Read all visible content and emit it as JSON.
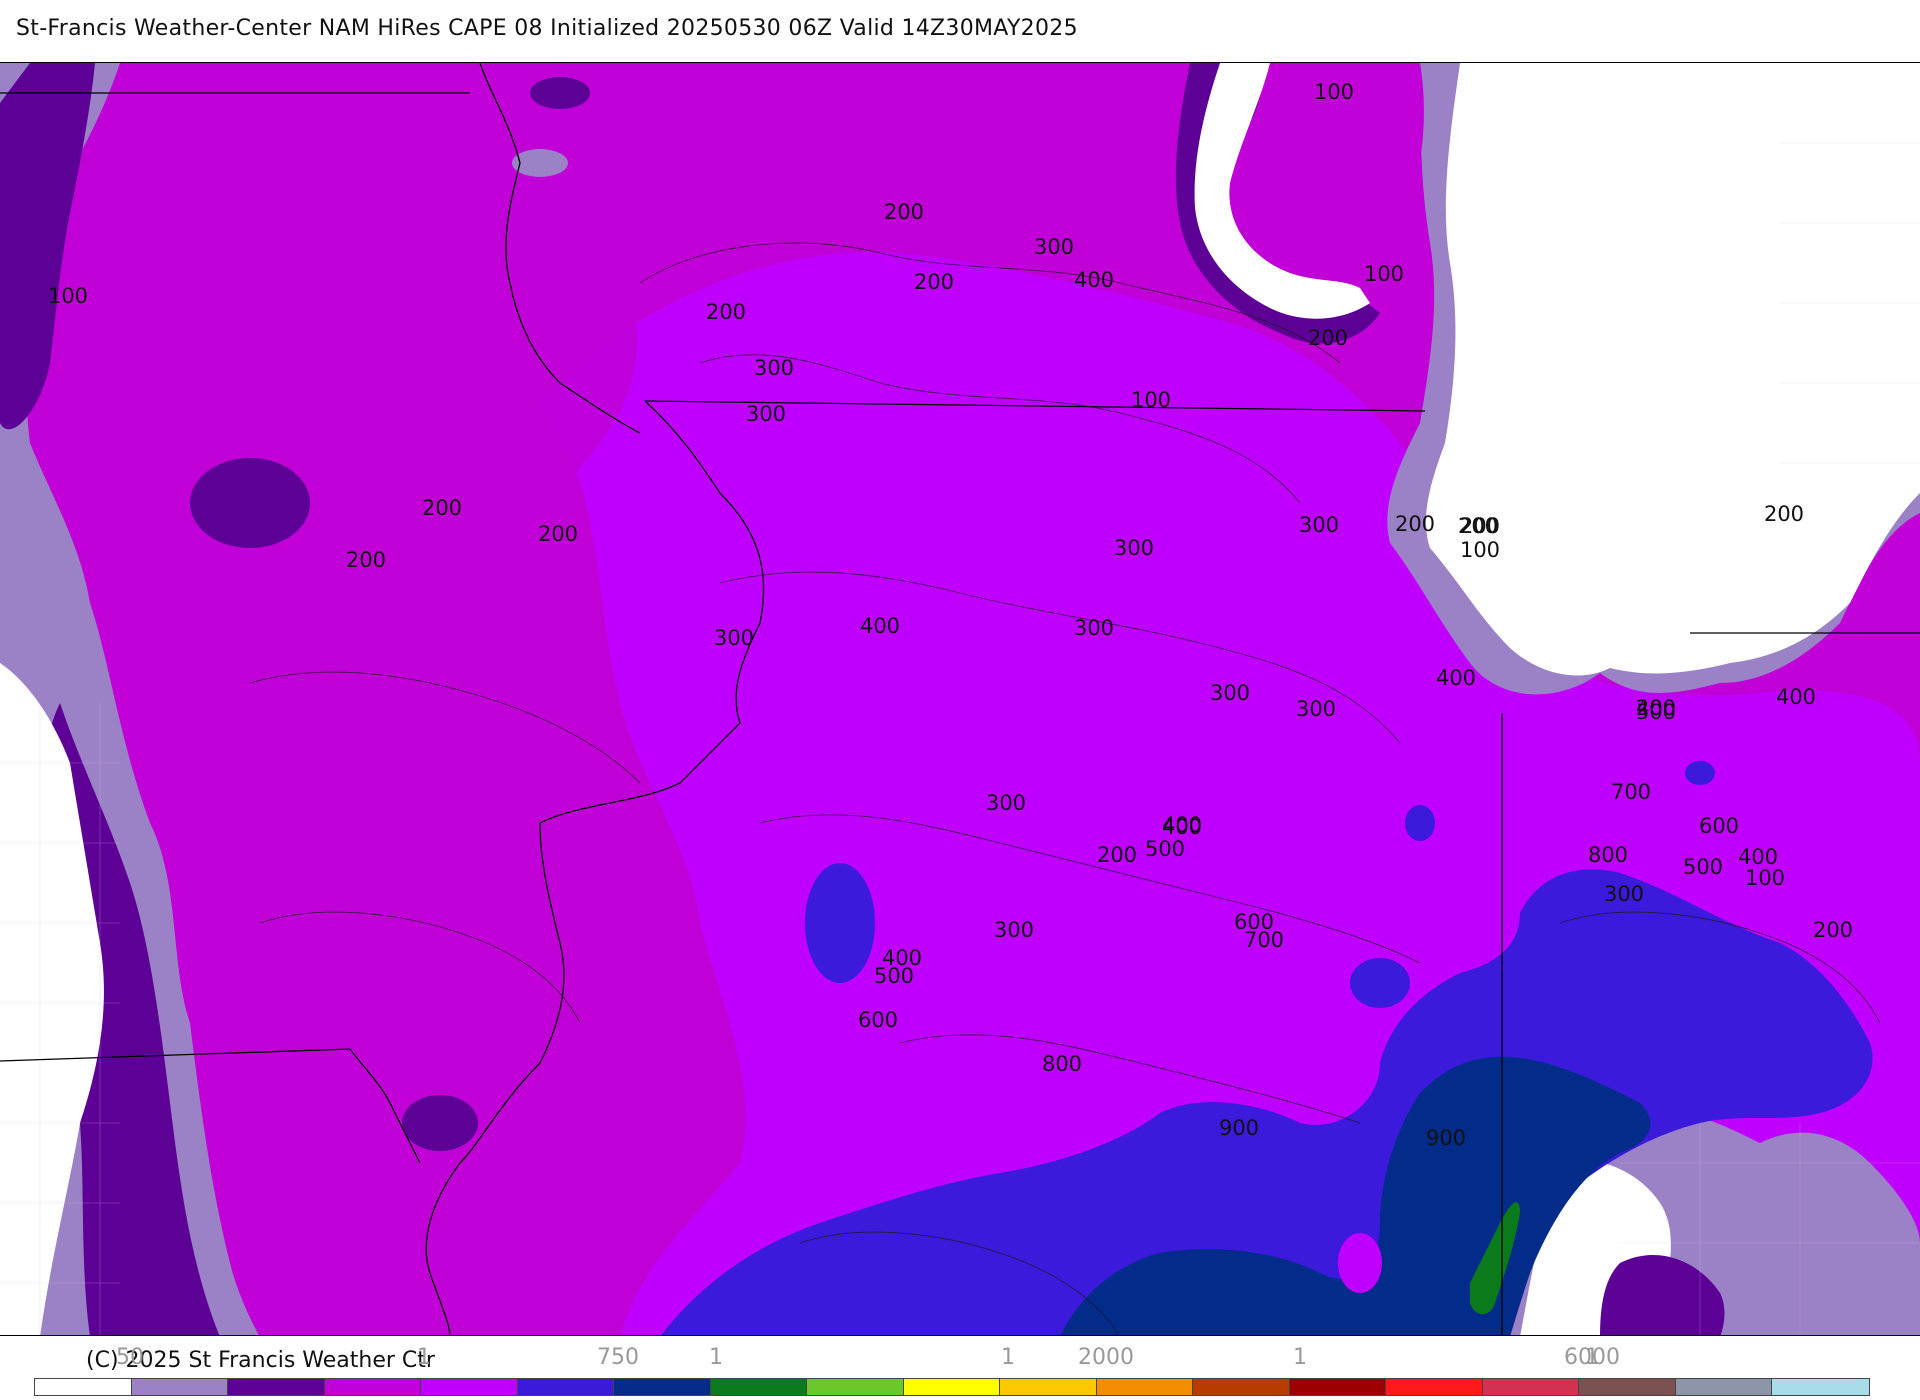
{
  "title": "St-Francis Weather-Center NAM HiRes CAPE  08 Initialized 20250530 06Z Valid 14Z30MAY2025",
  "copyright": "(C) 2025 St Francis Weather Ctr",
  "colorbar": {
    "colors": [
      "#ffffff",
      "#9b82c6",
      "#5c0096",
      "#c000d6",
      "#c000ff",
      "#3b1adb",
      "#032b8a",
      "#0a7a1a",
      "#6cc82a",
      "#ffff00",
      "#ffc800",
      "#f28c00",
      "#b83c00",
      "#9c0000",
      "#ff1a1a",
      "#d43050",
      "#7a5050",
      "#8c96a8",
      "#a8dce8"
    ],
    "tick_labels": [
      "50",
      "1",
      "750",
      "1",
      "1",
      "2000",
      "1",
      "6000",
      "1"
    ]
  },
  "contour_labels": [
    "100",
    "100",
    "100",
    "200",
    "200",
    "300",
    "400",
    "200",
    "200",
    "200",
    "300",
    "300",
    "100",
    "200",
    "200",
    "200",
    "200",
    "300",
    "300",
    "200",
    "200",
    "100",
    "400",
    "300",
    "300",
    "400",
    "300",
    "300",
    "400",
    "400",
    "200",
    "500",
    "700",
    "300",
    "400",
    "400",
    "500",
    "200",
    "600",
    "800",
    "500",
    "400",
    "100",
    "300",
    "200",
    "600",
    "300",
    "700",
    "400",
    "500",
    "600",
    "800",
    "900",
    "900"
  ],
  "regions": {
    "lake_michigan": "white",
    "low_cape_fill": "#9b82c6",
    "very_low_fill": "#5c0096",
    "mid_fill": "#c000d6",
    "high_fill": "#c000ff",
    "blue_fill": "#3b1adb",
    "navy_fill": "#032b8a",
    "green_fill": "#0a7a1a"
  }
}
